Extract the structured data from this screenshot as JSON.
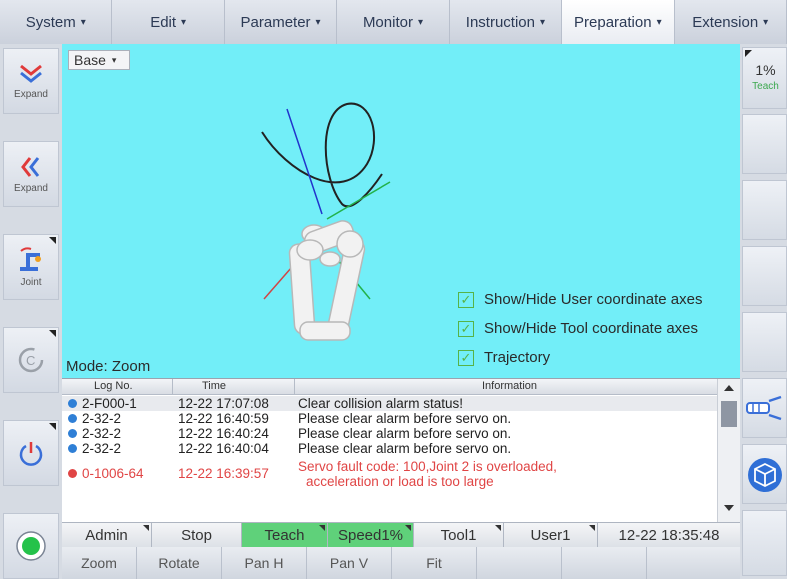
{
  "menu": [
    {
      "label": "System",
      "caret": "▾"
    },
    {
      "label": "Edit",
      "caret": "▾"
    },
    {
      "label": "Parameter",
      "caret": "▾"
    },
    {
      "label": "Monitor",
      "caret": "▾"
    },
    {
      "label": "Instruction",
      "caret": "▾"
    },
    {
      "label": "Preparation",
      "caret": "▾"
    },
    {
      "label": "Extension",
      "caret": "▾"
    }
  ],
  "left": {
    "expand_top": "Expand",
    "expand_left": "Expand",
    "joint": "Joint"
  },
  "right": {
    "speed_value": "1%",
    "speed_mode": "Teach"
  },
  "viewport": {
    "frame": "Base",
    "frame_caret": "▾",
    "mode": "Mode: Zoom",
    "options": [
      {
        "label": "Show/Hide User coordinate axes",
        "checked": true
      },
      {
        "label": "Show/Hide Tool coordinate axes",
        "checked": true
      },
      {
        "label": "Trajectory",
        "checked": true
      }
    ]
  },
  "log": {
    "headers": [
      "Log No.",
      "Time",
      "Information"
    ],
    "rows": [
      {
        "no": "2-F000-1",
        "time": "12-22 17:07:08",
        "info": "Clear collision alarm status!",
        "level": "info",
        "info2": ""
      },
      {
        "no": "2-32-2",
        "time": "12-22 16:40:59",
        "info": "Please clear alarm before servo on.",
        "level": "info",
        "info2": ""
      },
      {
        "no": "2-32-2",
        "time": "12-22 16:40:24",
        "info": "Please clear alarm before servo on.",
        "level": "info",
        "info2": ""
      },
      {
        "no": "2-32-2",
        "time": "12-22 16:40:04",
        "info": "Please clear alarm before servo on.",
        "level": "info",
        "info2": ""
      },
      {
        "no": "0-1006-64",
        "time": "12-22 16:39:57",
        "info": "Servo fault code: 100,Joint 2 is overloaded,",
        "level": "error",
        "info2": "acceleration or load is too large"
      }
    ]
  },
  "status": {
    "user": "Admin",
    "state": "Stop",
    "mode": "Teach",
    "speed": "Speed1%",
    "tool": "Tool1",
    "coord": "User1",
    "datetime": "12-22 18:35:48"
  },
  "toolbar": [
    "Zoom",
    "Rotate",
    "Pan H",
    "Pan V",
    "Fit",
    "",
    "",
    "",
    ""
  ],
  "colors": {
    "viewport_bg": "#72eef8",
    "status_green": "#5fd17a",
    "info_blue": "#2f7fd6",
    "error_red": "#e04545",
    "check_green": "#57b347"
  }
}
